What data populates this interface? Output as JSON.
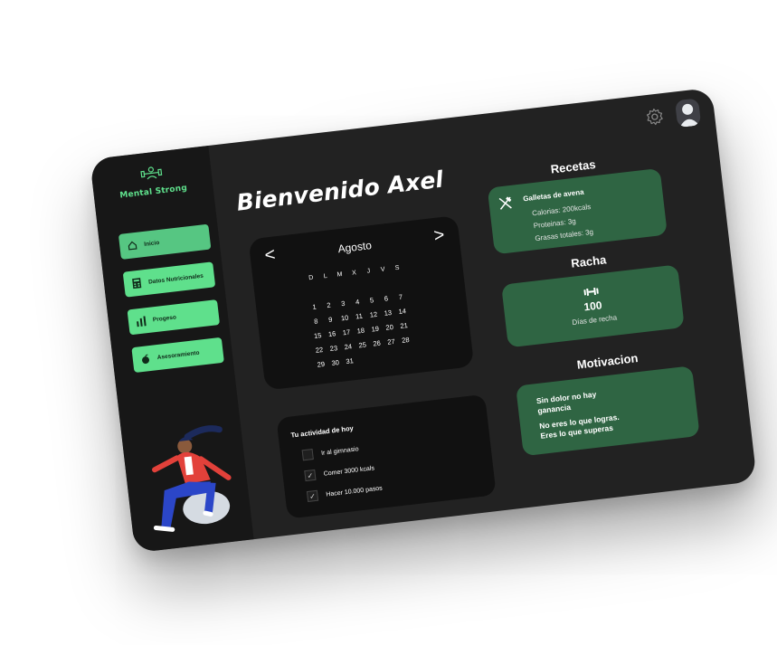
{
  "app": {
    "logo_text": "Mental Strong",
    "greeting": "Bienvenido Axel"
  },
  "sidebar": {
    "items": [
      {
        "label": "Inicio",
        "icon": "home-icon"
      },
      {
        "label": "Datos Nutricionales",
        "icon": "calculator-icon"
      },
      {
        "label": "Progeso",
        "icon": "bar-chart-icon"
      },
      {
        "label": "Asesoramiento",
        "icon": "apple-icon"
      }
    ]
  },
  "calendar": {
    "month": "Agosto",
    "prev": "<",
    "next": ">",
    "weekdays": [
      "D",
      "L",
      "M",
      "X",
      "J",
      "V",
      "S"
    ],
    "rows": [
      [
        "",
        "",
        "",
        "",
        "",
        "",
        ""
      ],
      [
        "1",
        "2",
        "3",
        "4",
        "5",
        "6",
        "7"
      ],
      [
        "8",
        "9",
        "10",
        "11",
        "12",
        "13",
        "14"
      ],
      [
        "15",
        "16",
        "17",
        "18",
        "19",
        "20",
        "21"
      ],
      [
        "22",
        "23",
        "24",
        "25",
        "26",
        "27",
        "28"
      ],
      [
        "29",
        "30",
        "31",
        "",
        "",
        "",
        ""
      ]
    ]
  },
  "activity": {
    "title": "Tu actividad de hoy",
    "items": [
      {
        "label": "Ir al gimnasio",
        "checked": false
      },
      {
        "label": "Comer 3000 kcals",
        "checked": true
      },
      {
        "label": "Hacer 10.000 pasos",
        "checked": true
      }
    ]
  },
  "recetas": {
    "title": "Recetas",
    "name": "Galletas de avena",
    "lines": [
      "Calorias: 200kcals",
      "Proteinas: 3g",
      "Grasas totales: 3g"
    ]
  },
  "racha": {
    "title": "Racha",
    "value": "100",
    "label": "Días de recha"
  },
  "motivacion": {
    "title": "Motivacion",
    "lines": [
      "Sin dolor no hay",
      "ganancia",
      "No eres lo que logras.",
      "Eres lo que superas"
    ]
  },
  "colors": {
    "accent": "#5fe08c",
    "card": "#2f6543",
    "panel": "#222222",
    "sidebar": "#171717"
  }
}
